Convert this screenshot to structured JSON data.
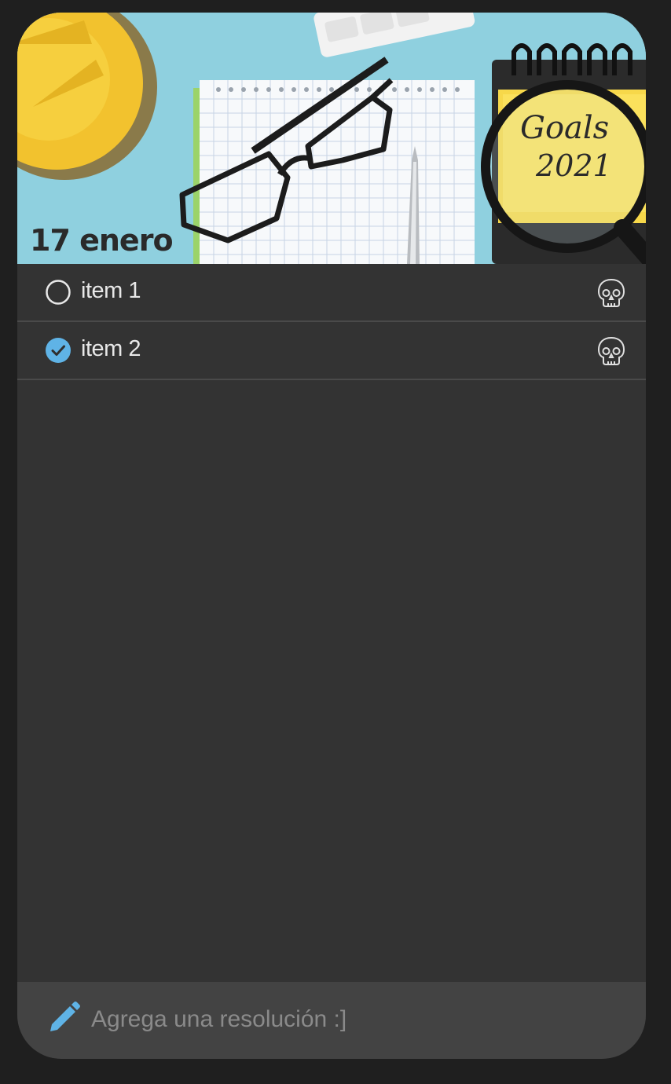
{
  "header": {
    "date_label": "17 enero",
    "image_label": "Goals\n2021",
    "note_line1": "Goals",
    "note_line2": "2021"
  },
  "items": [
    {
      "label": "item 1",
      "done": false,
      "delete_icon": "skull-icon"
    },
    {
      "label": "item 2",
      "done": true,
      "delete_icon": "skull-icon"
    }
  ],
  "footer": {
    "placeholder": "Agrega una resolución :]",
    "value": "",
    "icon": "pencil-icon"
  },
  "colors": {
    "background": "#1f1f1f",
    "card": "#333333",
    "footer": "#434343",
    "accent": "#5fb3e6",
    "divider": "#4a4a4a"
  }
}
